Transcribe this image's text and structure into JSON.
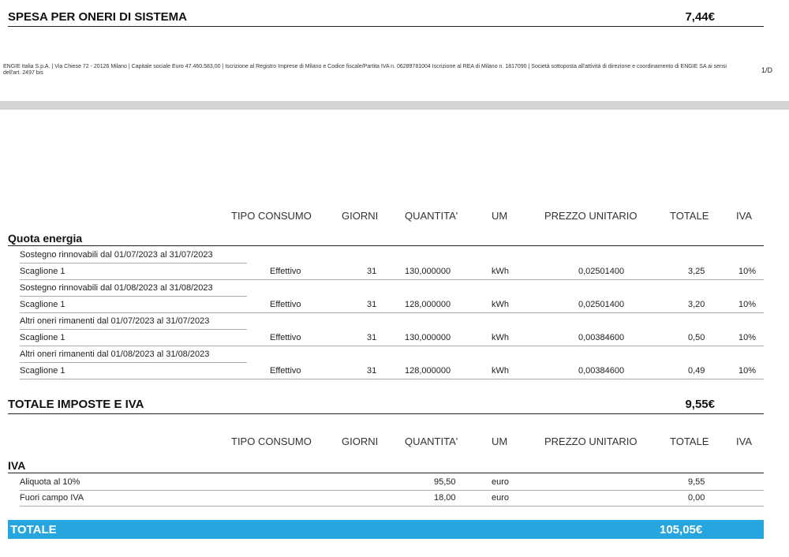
{
  "oneri_sistema": {
    "label": "SPESA PER ONERI DI SISTEMA",
    "amount": "7,44€"
  },
  "footer": {
    "legal": "ENGIE Italia S.p.A. | Via Chiese 72 - 20126 Milano | Capitale sociale Euro 47.460.583,00 | Iscrizione al Registro Imprese di Milano e Codice fiscale/Partita IVA n. 06289781004 Iscrizione al REA di Milano n. 1817090 | Società sottoposta all'attività di direzione e coordinamento di ENGIE SA ai sensi dell'art. 2497 bis",
    "page": "1/D"
  },
  "columns": {
    "tipo_consumo": "TIPO CONSUMO",
    "giorni": "GIORNI",
    "quantita": "QUANTITA'",
    "um": "UM",
    "prezzo_unitario": "PREZZO UNITARIO",
    "totale": "TOTALE",
    "iva": "IVA"
  },
  "quota_energia": {
    "title": "Quota energia",
    "periods": [
      {
        "label": "Sostegno rinnovabili dal 01/07/2023 al 31/07/2023",
        "row": {
          "scaglione": "Scaglione 1",
          "tipo": "Effettivo",
          "giorni": "31",
          "quantita": "130,000000",
          "um": "kWh",
          "prezzo": "0,02501400",
          "totale": "3,25",
          "iva": "10%"
        }
      },
      {
        "label": "Sostegno rinnovabili dal 01/08/2023 al 31/08/2023",
        "row": {
          "scaglione": "Scaglione 1",
          "tipo": "Effettivo",
          "giorni": "31",
          "quantita": "128,000000",
          "um": "kWh",
          "prezzo": "0,02501400",
          "totale": "3,20",
          "iva": "10%"
        }
      },
      {
        "label": "Altri oneri rimanenti dal 01/07/2023 al 31/07/2023",
        "row": {
          "scaglione": "Scaglione 1",
          "tipo": "Effettivo",
          "giorni": "31",
          "quantita": "130,000000",
          "um": "kWh",
          "prezzo": "0,00384600",
          "totale": "0,50",
          "iva": "10%"
        }
      },
      {
        "label": "Altri oneri rimanenti dal 01/08/2023 al 31/08/2023",
        "row": {
          "scaglione": "Scaglione 1",
          "tipo": "Effettivo",
          "giorni": "31",
          "quantita": "128,000000",
          "um": "kWh",
          "prezzo": "0,00384600",
          "totale": "0,49",
          "iva": "10%"
        }
      }
    ]
  },
  "imposte_iva": {
    "label": "TOTALE IMPOSTE E IVA",
    "amount": "9,55€"
  },
  "iva_group": {
    "title": "IVA",
    "rows": [
      {
        "label": "Aliquota al 10%",
        "quantita": "95,50",
        "um": "euro",
        "totale": "9,55"
      },
      {
        "label": "Fuori campo IVA",
        "quantita": "18,00",
        "um": "euro",
        "totale": "0,00"
      }
    ]
  },
  "grand_total": {
    "label": "TOTALE",
    "amount": "105,05€"
  },
  "colors": {
    "total_bar": "#27a5de",
    "divider": "#d3d3d3"
  }
}
